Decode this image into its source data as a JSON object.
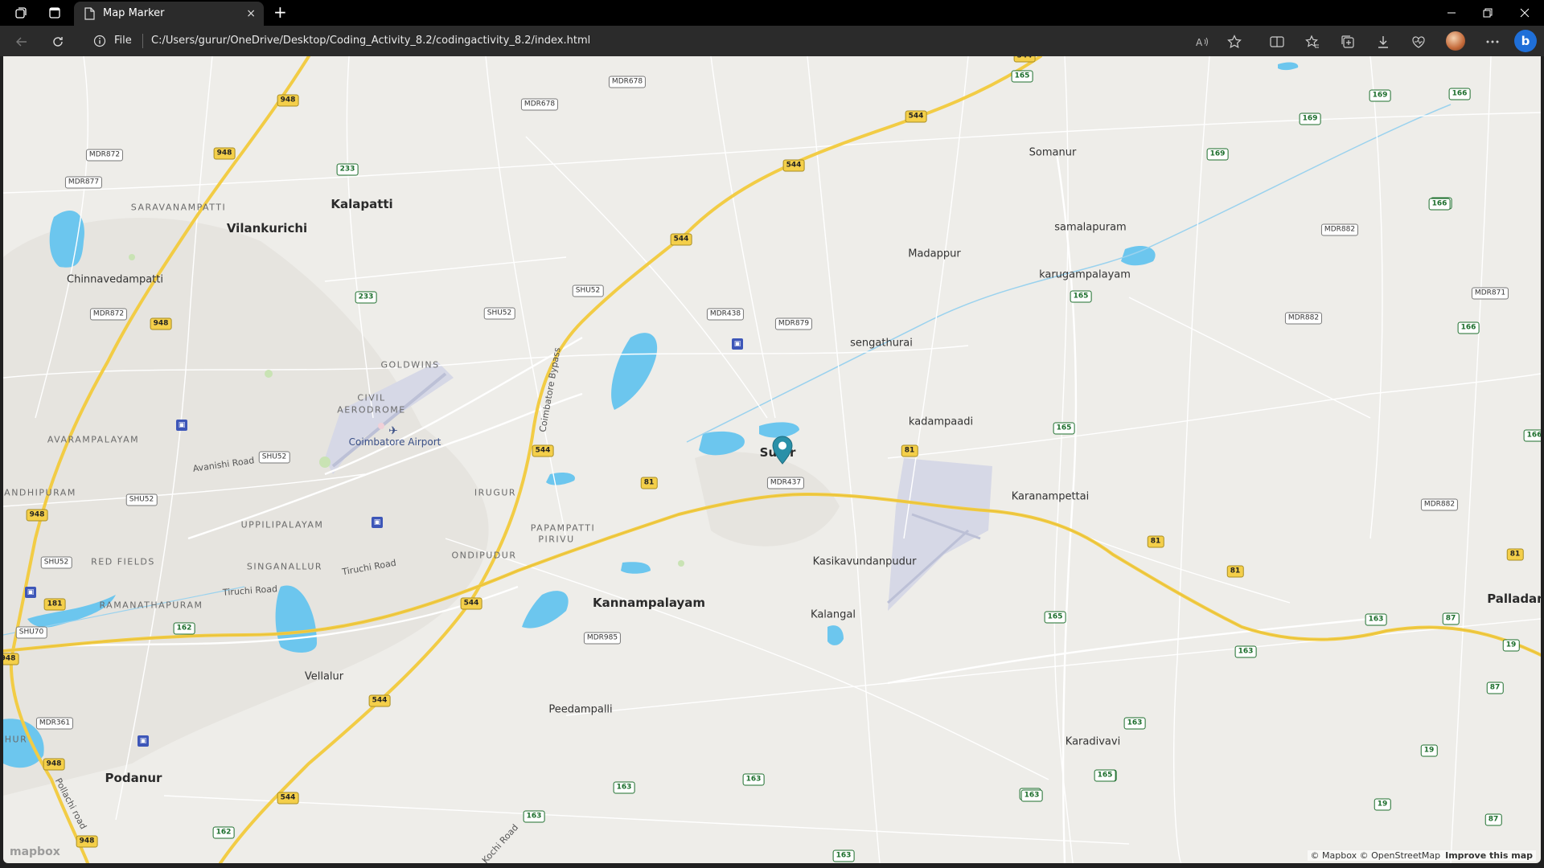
{
  "browser": {
    "tab_title": "Map Marker",
    "tab_close": "×",
    "new_tab": "+",
    "scheme_label": "File",
    "url": "C:/Users/gurur/OneDrive/Desktop/Coding_Activity_8.2/codingactivity_8.2/index.html",
    "window_controls": [
      "minimize-icon",
      "restore-icon",
      "close-icon"
    ]
  },
  "map": {
    "places_big": [
      "Kalapatti",
      "Vilankurichi",
      "Kannampalayam",
      "Podanur",
      "Palladam",
      "Sulur"
    ],
    "places_mid": [
      "Chinnavedampatti",
      "Somanur",
      "samalapuram",
      "karugampalayam",
      "Madappur",
      "sengathurai",
      "kadampaadi",
      "Karanampettai",
      "Kasikavundanpudur",
      "Kalangal",
      "Vellalur",
      "Peedampalli",
      "Karadivavi"
    ],
    "neighborhoods": [
      "SARAVANAMPATTI",
      "GOLDWINS",
      "CIVIL",
      "AERODROME",
      "AVARAMPALAYAM",
      "ANDHIPURAM",
      "IRUGUR",
      "UPPILIPALAYAM",
      "PAPAMPATTI",
      "PIRIVU",
      "RED FIELDS",
      "SINGANALLUR",
      "ONDIPUDUR",
      "RAMANATHAPURAM",
      "HUR"
    ],
    "airport": "Coimbatore Airport",
    "roads": [
      "Avanishi Road",
      "Tiruchi Road",
      "Tiruchi Road",
      "Coimbatore Bypass",
      "Pollachi road",
      "Kochi Road"
    ],
    "shields_nh": [
      "948",
      "948",
      "948",
      "948",
      "948",
      "948",
      "544",
      "544",
      "544",
      "544",
      "544",
      "544",
      "544",
      "544",
      "81",
      "81",
      "81",
      "81",
      "81",
      "181",
      "948"
    ],
    "shields_sh": [
      "165",
      "165",
      "165",
      "165",
      "165",
      "166",
      "166",
      "166",
      "166",
      "169",
      "169",
      "169",
      "233",
      "233",
      "162",
      "162",
      "163",
      "163",
      "163",
      "163",
      "163",
      "163",
      "163",
      "163",
      "163",
      "87",
      "87",
      "87",
      "19",
      "19",
      "19",
      "165",
      "166"
    ],
    "shields_mdr": [
      "MDR872",
      "MDR877",
      "MDR872",
      "MDR678",
      "MDR678",
      "MDR438",
      "MDR879",
      "MDR437",
      "MDR985",
      "MDR882",
      "MDR882",
      "MDR871",
      "MDR882",
      "SHU52",
      "SHU52",
      "SHU52",
      "SHU52",
      "SHU52",
      "SHU70",
      "MDR361"
    ],
    "marker_label": "Sulur",
    "logo": "mapbox",
    "attribution": "© Mapbox © OpenStreetMap",
    "improve": "Improve this map"
  },
  "colors": {
    "nh": "#f4cf4a",
    "water": "#6cc6ee",
    "land": "#eeede9",
    "airport": "#d6d8e6",
    "marker": "#2a90a8"
  }
}
